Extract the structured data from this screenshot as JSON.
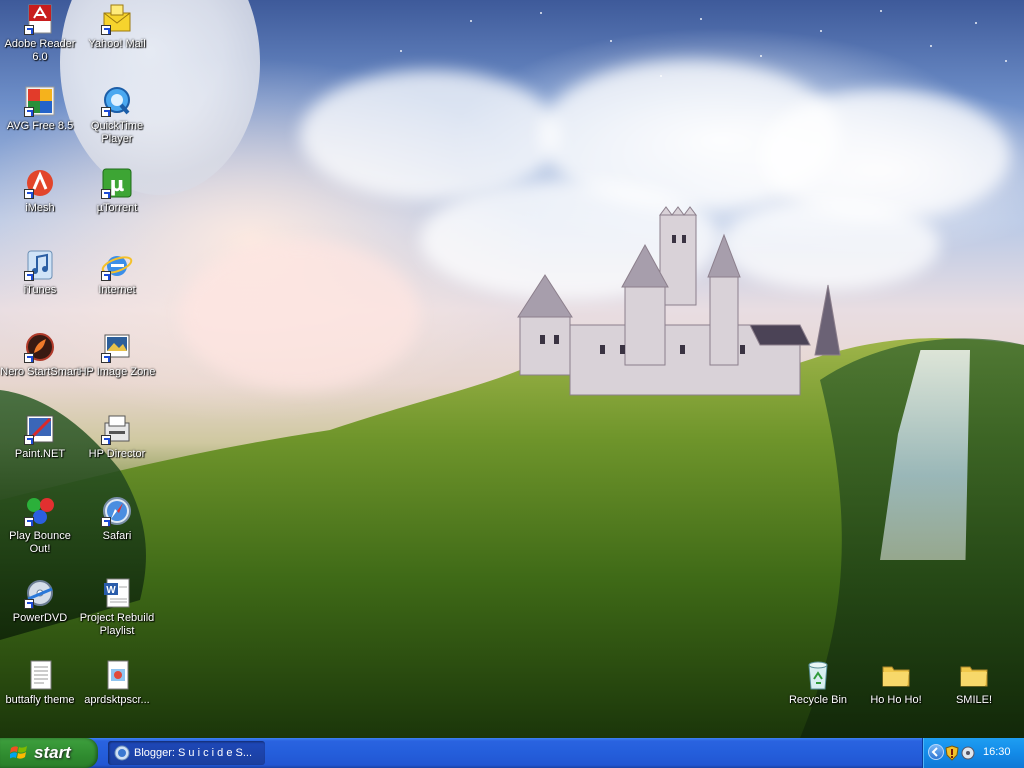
{
  "desktop": {
    "icons": [
      {
        "label": "Adobe Reader 6.0",
        "icon": "adobe-reader-icon"
      },
      {
        "label": "Yahoo! Mail",
        "icon": "yahoo-mail-icon"
      },
      {
        "label": "AVG Free 8.5",
        "icon": "avg-icon"
      },
      {
        "label": "QuickTime Player",
        "icon": "quicktime-icon"
      },
      {
        "label": "iMesh",
        "icon": "imesh-icon"
      },
      {
        "label": "µTorrent",
        "icon": "utorrent-icon"
      },
      {
        "label": "iTunes",
        "icon": "itunes-icon"
      },
      {
        "label": "Internet",
        "icon": "internet-explorer-icon"
      },
      {
        "label": "Nero StartSmart",
        "icon": "nero-icon"
      },
      {
        "label": "HP Image Zone",
        "icon": "hp-image-zone-icon"
      },
      {
        "label": "Paint.NET",
        "icon": "paint-net-icon"
      },
      {
        "label": "HP Director",
        "icon": "hp-director-icon"
      },
      {
        "label": "Play Bounce Out!",
        "icon": "bounce-out-icon"
      },
      {
        "label": "Safari",
        "icon": "safari-icon"
      },
      {
        "label": "PowerDVD",
        "icon": "powerdvd-icon"
      },
      {
        "label": "Project Rebuild Playlist",
        "icon": "word-document-icon"
      },
      {
        "label": "buttafly theme",
        "icon": "text-document-icon"
      },
      {
        "label": "aprdsktpscr...",
        "icon": "image-file-icon"
      },
      {
        "label": "Recycle Bin",
        "icon": "recycle-bin-icon"
      },
      {
        "label": "Ho Ho Ho!",
        "icon": "folder-icon"
      },
      {
        "label": "SMILE!",
        "icon": "folder-icon"
      }
    ]
  },
  "taskbar": {
    "start_label": "start",
    "tasks": [
      {
        "label": "Blogger: S u i c i d e S...",
        "icon": "browser-icon"
      }
    ],
    "tray": {
      "clock": "16:30",
      "icons": [
        "tray-expand-icon",
        "security-shield-icon",
        "network-icon",
        "volume-icon"
      ]
    }
  },
  "colors": {
    "taskbar_blue": "#245edb",
    "start_green": "#3a9b3a",
    "tray_blue": "#138be8"
  }
}
